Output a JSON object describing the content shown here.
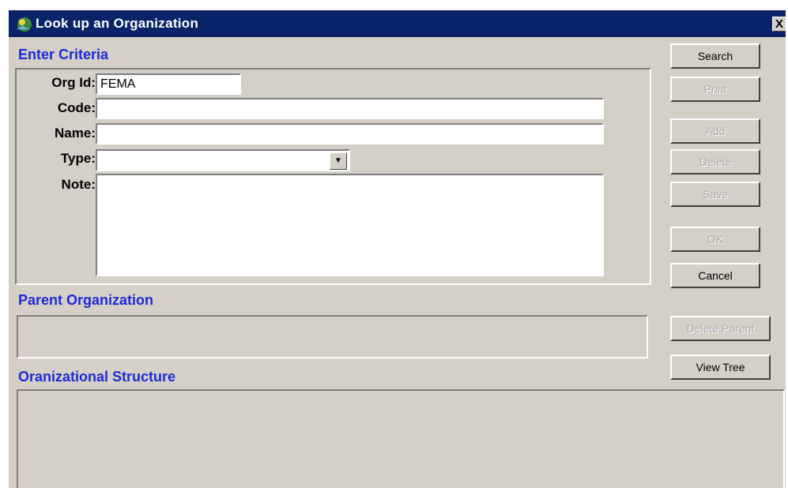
{
  "window": {
    "title": "Look up an Organization",
    "close_label": "X"
  },
  "criteria": {
    "heading": "Enter Criteria",
    "org_id_label": "Org Id:",
    "org_id_value": "FEMA",
    "code_label": "Code:",
    "code_value": "",
    "name_label": "Name:",
    "name_value": "",
    "type_label": "Type:",
    "type_value": "",
    "note_label": "Note:",
    "note_value": ""
  },
  "buttons": {
    "search": "Search",
    "print": "Print",
    "add": "Add",
    "delete": "Delete",
    "save": "Save",
    "ok": "OK",
    "cancel": "Cancel",
    "delete_parent": "Delete Parent",
    "view_tree": "View Tree"
  },
  "parent": {
    "heading": "Parent Organization",
    "value": ""
  },
  "structure": {
    "heading": "Oranizational Structure"
  },
  "colors": {
    "titlebar": "#0a246a",
    "heading": "#1e2ad8",
    "face": "#d4d0c8"
  }
}
